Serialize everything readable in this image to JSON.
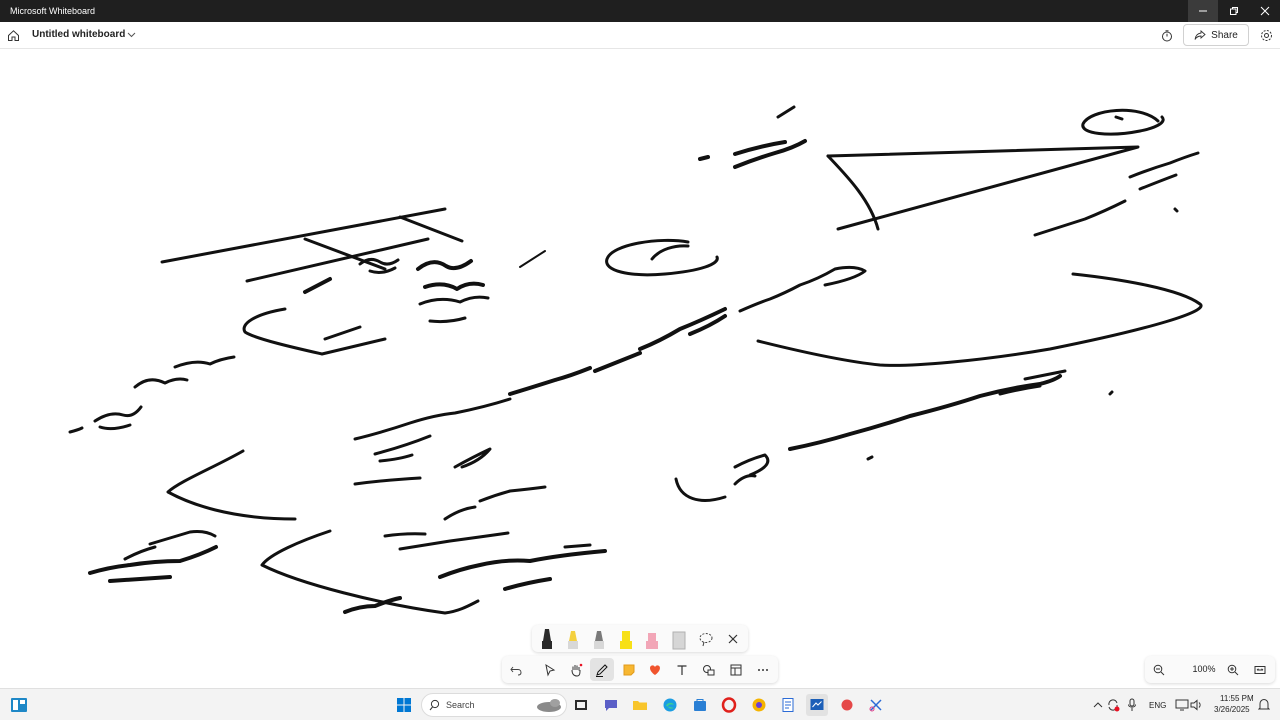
{
  "window": {
    "app_title": "Microsoft Whiteboard"
  },
  "appbar": {
    "doc_title": "Untitled whiteboard",
    "share_label": "Share"
  },
  "pen_tray": {
    "pens": [
      {
        "name": "black-pen",
        "color": "#1a1a1a"
      },
      {
        "name": "yellow-pen",
        "color": "#f4d03f"
      },
      {
        "name": "gray-pen",
        "color": "#8a8a8a"
      },
      {
        "name": "yellow-highlighter",
        "color": "#f7e017"
      },
      {
        "name": "pink-highlighter",
        "color": "#f2a6b7"
      },
      {
        "name": "eraser",
        "color": "#c8c8c8"
      }
    ]
  },
  "toolbar": {
    "tools": [
      "undo",
      "select",
      "pan",
      "ink",
      "note",
      "reactions",
      "text",
      "shapes",
      "templates",
      "more"
    ],
    "selected_tool": "ink"
  },
  "zoom": {
    "level": "100%"
  },
  "taskbar": {
    "search_placeholder": "Search",
    "language": "ENG",
    "time": "11:55 PM",
    "date": "3/26/2025"
  },
  "colors": {
    "titlebar": "#1f1f1f",
    "accent": "#0078d4",
    "ink": "#111111"
  }
}
